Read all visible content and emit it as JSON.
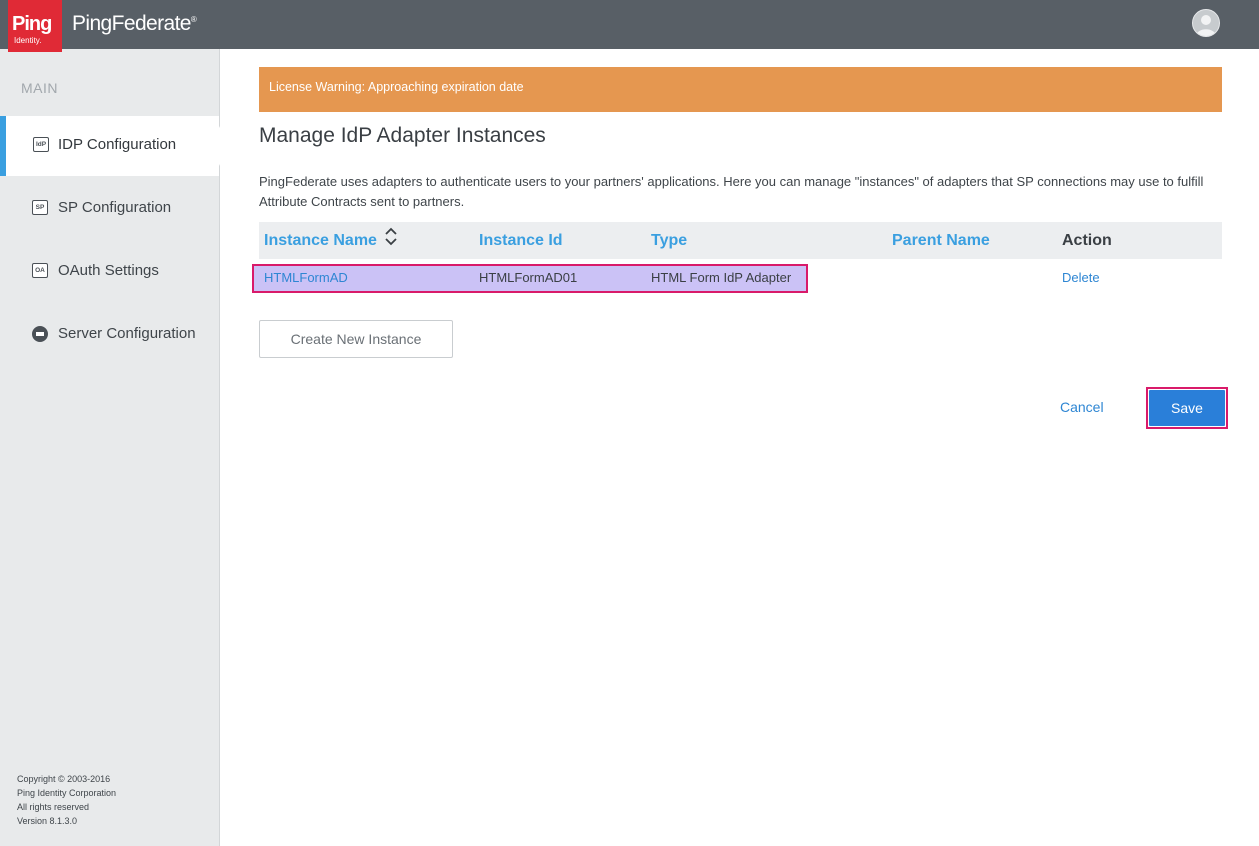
{
  "header": {
    "logo_text": "Ping",
    "logo_subtext": "Identity.",
    "product_name": "PingFederate",
    "product_mark": "®",
    "user_icon": "user-avatar-icon"
  },
  "sidebar": {
    "heading": "MAIN",
    "items": [
      {
        "label": "IDP Configuration",
        "icon_text": "IdP",
        "icon": "idp-icon",
        "active": true
      },
      {
        "label": "SP Configuration",
        "icon_text": "SP",
        "icon": "sp-icon",
        "active": false
      },
      {
        "label": "OAuth Settings",
        "icon_text": "OA",
        "icon": "oauth-icon",
        "active": false
      },
      {
        "label": "Server Configuration",
        "icon_text": "",
        "icon": "server-icon",
        "active": false
      }
    ],
    "footer": {
      "copyright": "Copyright © 2003-2016",
      "company": "Ping Identity Corporation",
      "rights": "All rights reserved",
      "version": "Version 8.1.3.0"
    }
  },
  "main": {
    "license_warning": "License Warning: Approaching expiration date",
    "title": "Manage IdP Adapter Instances",
    "description": "PingFederate uses adapters to authenticate users to your partners' applications. Here you can manage \"instances\" of adapters that SP connections may use to fulfill Attribute Contracts sent to partners.",
    "table": {
      "columns": [
        "Instance Name",
        "Instance Id",
        "Type",
        "Parent Name",
        "Action"
      ],
      "rows": [
        {
          "instance_name": "HTMLFormAD",
          "instance_id": "HTMLFormAD01",
          "type": "HTML Form IdP Adapter",
          "parent_name": "",
          "action": "Delete"
        }
      ]
    },
    "create_button": "Create New Instance",
    "cancel_label": "Cancel",
    "save_label": "Save"
  },
  "colors": {
    "header_bg": "#585f66",
    "brand_red": "#e02a36",
    "accent_blue": "#3a9fe0",
    "warning_orange": "#e59750",
    "highlight": "#d91a6a",
    "row_selected": "#cbc2f6",
    "save_blue": "#2a7fd9"
  }
}
